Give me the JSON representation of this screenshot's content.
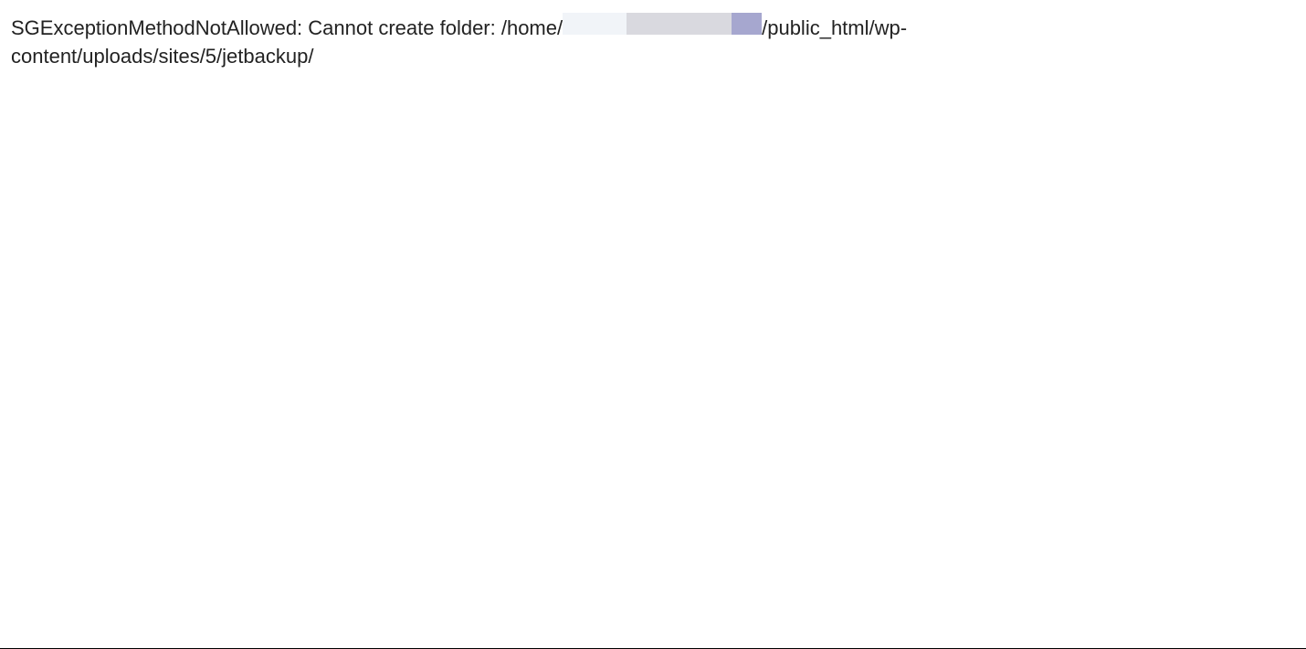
{
  "error": {
    "prefix": "SGExceptionMethodNotAllowed: Cannot create folder: /home/",
    "suffix_line1_after_redaction": "/public_html/wp-",
    "line2": "content/uploads/sites/5/jetbackup/"
  }
}
